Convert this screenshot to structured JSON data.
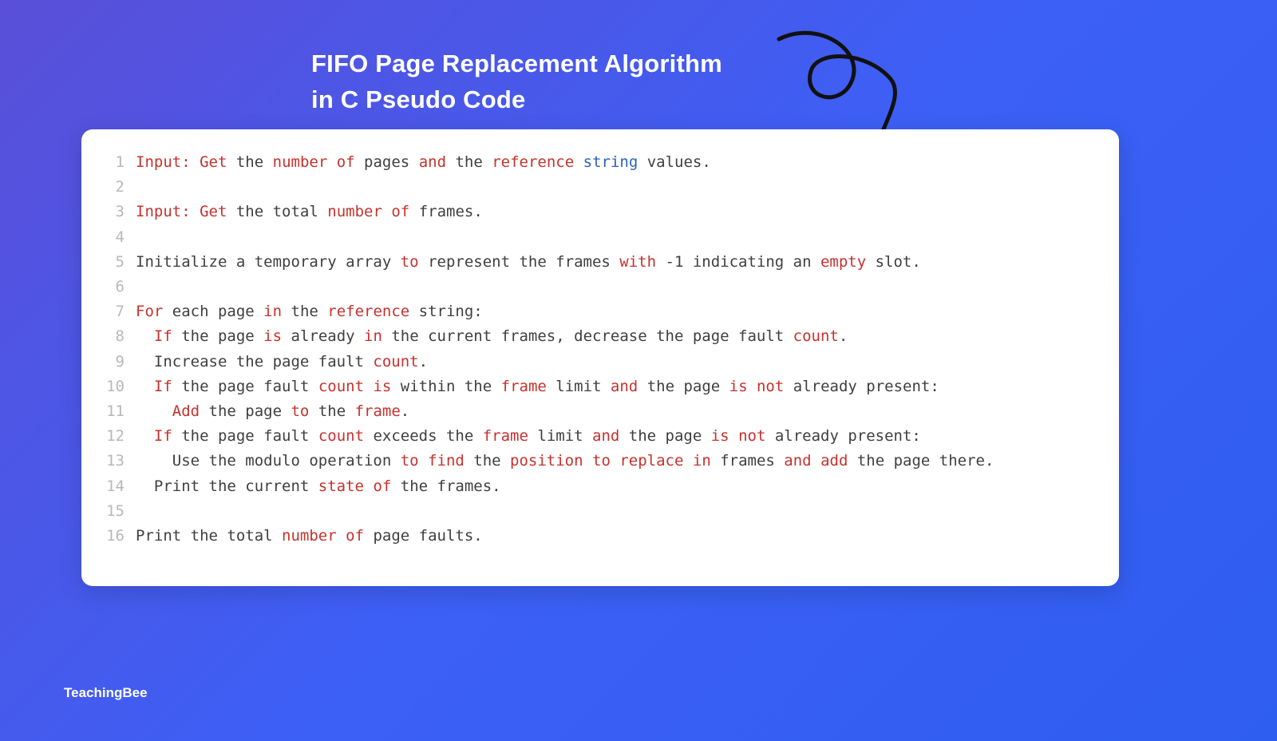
{
  "header": {
    "title_line1": "FIFO Page Replacement Algorithm",
    "title_line2": "in C Pseudo Code"
  },
  "footer": {
    "brand": "TeachingBee"
  },
  "code": {
    "lines": [
      {
        "n": "1",
        "segs": [
          {
            "c": "kw",
            "t": "Input:"
          },
          {
            "c": "txt",
            "t": " "
          },
          {
            "c": "kw",
            "t": "Get"
          },
          {
            "c": "txt",
            "t": " the "
          },
          {
            "c": "kw",
            "t": "number"
          },
          {
            "c": "txt",
            "t": " "
          },
          {
            "c": "kw",
            "t": "of"
          },
          {
            "c": "txt",
            "t": " pages "
          },
          {
            "c": "kw",
            "t": "and"
          },
          {
            "c": "txt",
            "t": " the "
          },
          {
            "c": "kw",
            "t": "reference"
          },
          {
            "c": "txt",
            "t": " "
          },
          {
            "c": "str",
            "t": "string"
          },
          {
            "c": "txt",
            "t": " values."
          }
        ]
      },
      {
        "n": "2",
        "segs": []
      },
      {
        "n": "3",
        "segs": [
          {
            "c": "kw",
            "t": "Input:"
          },
          {
            "c": "txt",
            "t": " "
          },
          {
            "c": "kw",
            "t": "Get"
          },
          {
            "c": "txt",
            "t": " the total "
          },
          {
            "c": "kw",
            "t": "number"
          },
          {
            "c": "txt",
            "t": " "
          },
          {
            "c": "kw",
            "t": "of"
          },
          {
            "c": "txt",
            "t": " frames."
          }
        ]
      },
      {
        "n": "4",
        "segs": []
      },
      {
        "n": "5",
        "segs": [
          {
            "c": "txt",
            "t": "Initialize a temporary array "
          },
          {
            "c": "kw",
            "t": "to"
          },
          {
            "c": "txt",
            "t": " represent the frames "
          },
          {
            "c": "kw",
            "t": "with"
          },
          {
            "c": "txt",
            "t": " -1 indicating an "
          },
          {
            "c": "kw",
            "t": "empty"
          },
          {
            "c": "txt",
            "t": " slot."
          }
        ]
      },
      {
        "n": "6",
        "segs": []
      },
      {
        "n": "7",
        "segs": [
          {
            "c": "kw",
            "t": "For"
          },
          {
            "c": "txt",
            "t": " each page "
          },
          {
            "c": "kw",
            "t": "in"
          },
          {
            "c": "txt",
            "t": " the "
          },
          {
            "c": "kw",
            "t": "reference"
          },
          {
            "c": "txt",
            "t": " string:"
          }
        ]
      },
      {
        "n": "8",
        "segs": [
          {
            "c": "txt",
            "t": "  "
          },
          {
            "c": "kw",
            "t": "If"
          },
          {
            "c": "txt",
            "t": " the page "
          },
          {
            "c": "kw",
            "t": "is"
          },
          {
            "c": "txt",
            "t": " already "
          },
          {
            "c": "kw",
            "t": "in"
          },
          {
            "c": "txt",
            "t": " the current frames, decrease the page fault "
          },
          {
            "c": "kw",
            "t": "count"
          },
          {
            "c": "txt",
            "t": "."
          }
        ]
      },
      {
        "n": "9",
        "segs": [
          {
            "c": "txt",
            "t": "  Increase the page fault "
          },
          {
            "c": "kw",
            "t": "count"
          },
          {
            "c": "txt",
            "t": "."
          }
        ]
      },
      {
        "n": "10",
        "segs": [
          {
            "c": "txt",
            "t": "  "
          },
          {
            "c": "kw",
            "t": "If"
          },
          {
            "c": "txt",
            "t": " the page fault "
          },
          {
            "c": "kw",
            "t": "count"
          },
          {
            "c": "txt",
            "t": " "
          },
          {
            "c": "kw",
            "t": "is"
          },
          {
            "c": "txt",
            "t": " within the "
          },
          {
            "c": "kw",
            "t": "frame"
          },
          {
            "c": "txt",
            "t": " limit "
          },
          {
            "c": "kw",
            "t": "and"
          },
          {
            "c": "txt",
            "t": " the page "
          },
          {
            "c": "kw",
            "t": "is"
          },
          {
            "c": "txt",
            "t": " "
          },
          {
            "c": "kw",
            "t": "not"
          },
          {
            "c": "txt",
            "t": " already present:"
          }
        ]
      },
      {
        "n": "11",
        "segs": [
          {
            "c": "txt",
            "t": "    "
          },
          {
            "c": "kw",
            "t": "Add"
          },
          {
            "c": "txt",
            "t": " the page "
          },
          {
            "c": "kw",
            "t": "to"
          },
          {
            "c": "txt",
            "t": " the "
          },
          {
            "c": "kw",
            "t": "frame"
          },
          {
            "c": "txt",
            "t": "."
          }
        ]
      },
      {
        "n": "12",
        "segs": [
          {
            "c": "txt",
            "t": "  "
          },
          {
            "c": "kw",
            "t": "If"
          },
          {
            "c": "txt",
            "t": " the page fault "
          },
          {
            "c": "kw",
            "t": "count"
          },
          {
            "c": "txt",
            "t": " exceeds the "
          },
          {
            "c": "kw",
            "t": "frame"
          },
          {
            "c": "txt",
            "t": " limit "
          },
          {
            "c": "kw",
            "t": "and"
          },
          {
            "c": "txt",
            "t": " the page "
          },
          {
            "c": "kw",
            "t": "is"
          },
          {
            "c": "txt",
            "t": " "
          },
          {
            "c": "kw",
            "t": "not"
          },
          {
            "c": "txt",
            "t": " already present:"
          }
        ]
      },
      {
        "n": "13",
        "segs": [
          {
            "c": "txt",
            "t": "    Use the modulo operation "
          },
          {
            "c": "kw",
            "t": "to"
          },
          {
            "c": "txt",
            "t": " "
          },
          {
            "c": "kw",
            "t": "find"
          },
          {
            "c": "txt",
            "t": " the "
          },
          {
            "c": "kw",
            "t": "position"
          },
          {
            "c": "txt",
            "t": " "
          },
          {
            "c": "kw",
            "t": "to"
          },
          {
            "c": "txt",
            "t": " "
          },
          {
            "c": "kw",
            "t": "replace"
          },
          {
            "c": "txt",
            "t": " "
          },
          {
            "c": "kw",
            "t": "in"
          },
          {
            "c": "txt",
            "t": " frames "
          },
          {
            "c": "kw",
            "t": "and"
          },
          {
            "c": "txt",
            "t": " "
          },
          {
            "c": "kw",
            "t": "add"
          },
          {
            "c": "txt",
            "t": " the page there."
          }
        ]
      },
      {
        "n": "14",
        "segs": [
          {
            "c": "txt",
            "t": "  Print the current "
          },
          {
            "c": "kw",
            "t": "state"
          },
          {
            "c": "txt",
            "t": " "
          },
          {
            "c": "kw",
            "t": "of"
          },
          {
            "c": "txt",
            "t": " the frames."
          }
        ]
      },
      {
        "n": "15",
        "segs": []
      },
      {
        "n": "16",
        "segs": [
          {
            "c": "txt",
            "t": "Print the total "
          },
          {
            "c": "kw",
            "t": "number"
          },
          {
            "c": "txt",
            "t": " "
          },
          {
            "c": "kw",
            "t": "of"
          },
          {
            "c": "txt",
            "t": " page faults."
          }
        ]
      }
    ]
  }
}
